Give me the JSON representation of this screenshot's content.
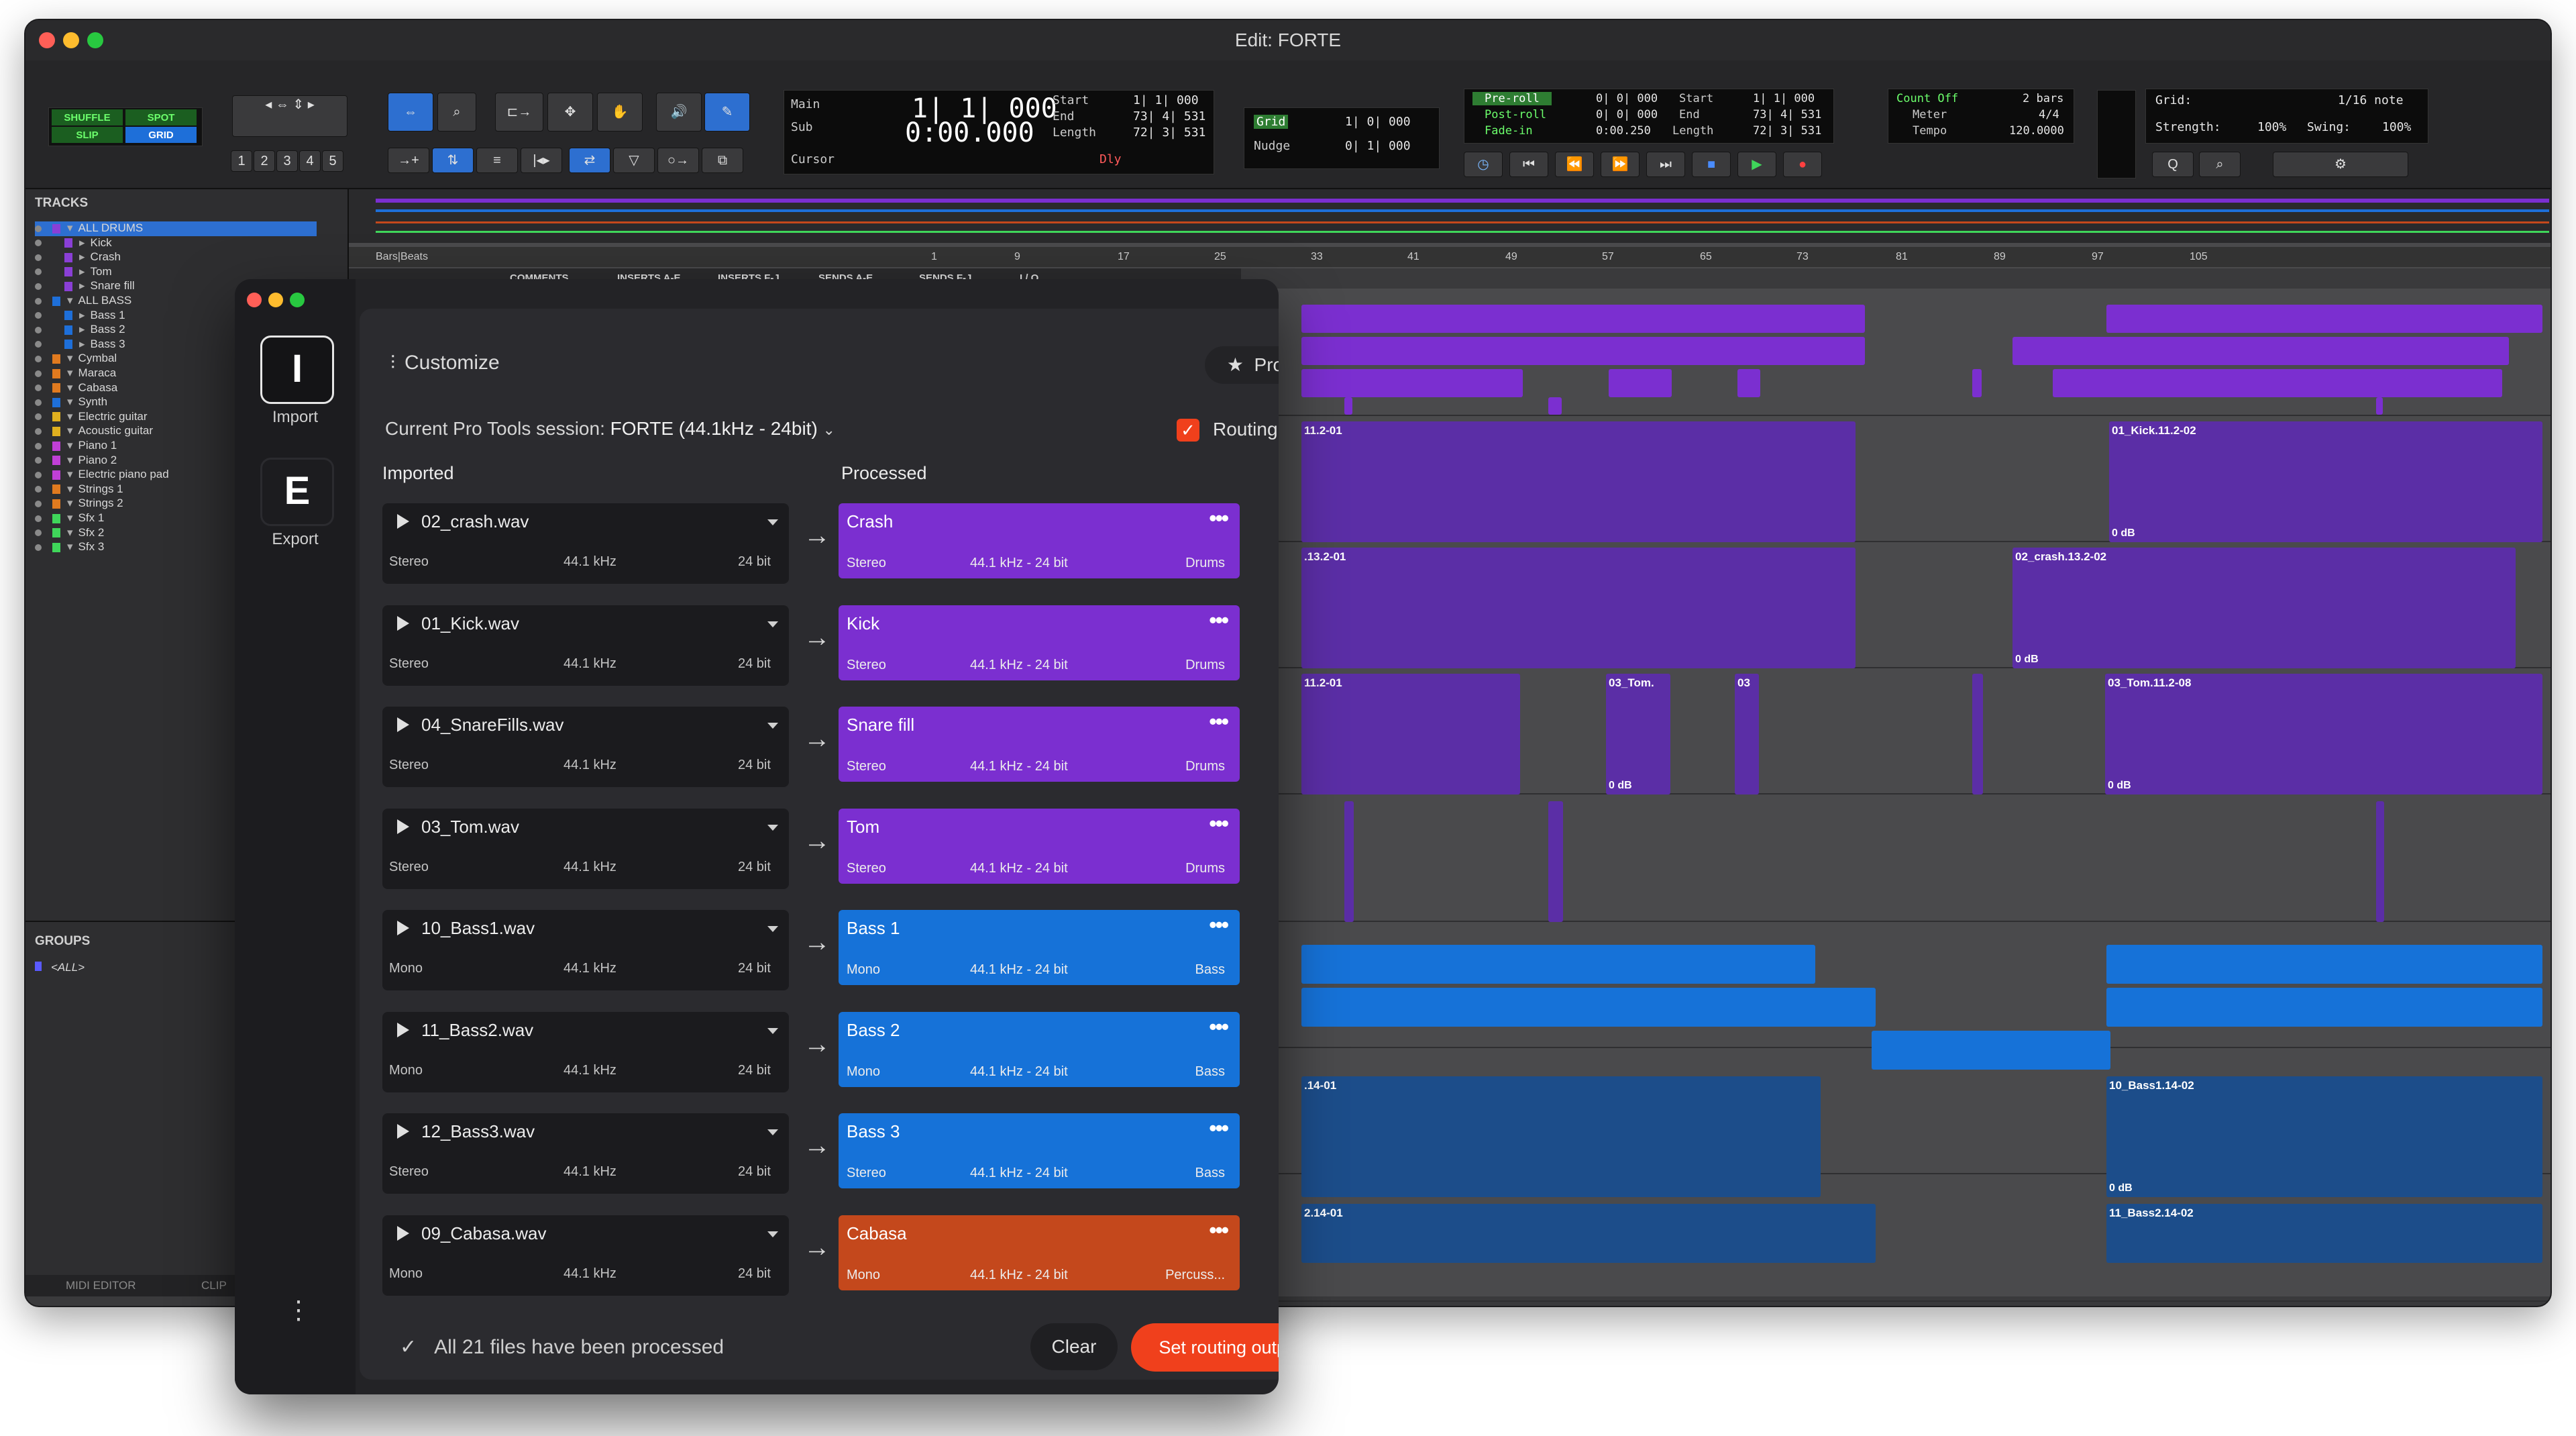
{
  "protools": {
    "window_title": "Edit: FORTE",
    "modes": {
      "shuffle": "SHUFFLE",
      "spot": "SPOT",
      "slip": "SLIP",
      "grid": "GRID"
    },
    "zoom_presets": [
      "1",
      "2",
      "3",
      "4",
      "5"
    ],
    "counters": {
      "main_label": "Main",
      "main_value": "1| 1| 000",
      "sub_label": "Sub",
      "sub_value": "0:00.000",
      "start_label": "Start",
      "start_value": "1| 1| 000",
      "end_label": "End",
      "end_value": "73| 4| 531",
      "length_label": "Length",
      "length_value": "72| 3| 531",
      "cursor_label": "Cursor",
      "dly_label": "Dly"
    },
    "grid_nudge": {
      "grid_label": "Grid",
      "grid_value": "1| 0| 000",
      "nudge_label": "Nudge",
      "nudge_value": "0| 1| 000"
    },
    "transport_lcd": {
      "preroll_label": "Pre-roll",
      "preroll_value": "0| 0| 000",
      "postroll_label": "Post-roll",
      "postroll_value": "0| 0| 000",
      "fadein_label": "Fade-in",
      "fadein_value": "0:00.250",
      "start_label": "Start",
      "start_value": "1| 1| 000",
      "end_label": "End",
      "end_value": "73| 4| 531",
      "length_label": "Length",
      "length_value": "72| 3| 531"
    },
    "count_meter": {
      "count_off_label": "Count Off",
      "count_off_value": "2 bars",
      "meter_label": "Meter",
      "meter_value": "4/4",
      "tempo_label": "Tempo",
      "tempo_value": "120.0000"
    },
    "grid_quant": {
      "grid_label": "Grid:",
      "grid_value": "1/16 note",
      "strength_label": "Strength:",
      "strength_value": "100%",
      "swing_label": "Swing:",
      "swing_value": "100%"
    },
    "tracks_header": "TRACKS",
    "groups_header": "GROUPS",
    "groups_all": "<ALL>",
    "bottom_tabs": [
      "MIDI EDITOR",
      "CLIP"
    ],
    "tracks": [
      {
        "name": "ALL DRUMS",
        "color": "#8a3fd6",
        "indent": 0
      },
      {
        "name": "Kick",
        "color": "#8a3fd6",
        "indent": 1
      },
      {
        "name": "Crash",
        "color": "#8a3fd6",
        "indent": 1
      },
      {
        "name": "Tom",
        "color": "#8a3fd6",
        "indent": 1
      },
      {
        "name": "Snare fill",
        "color": "#8a3fd6",
        "indent": 1
      },
      {
        "name": "ALL BASS",
        "color": "#1e6fd9",
        "indent": 0
      },
      {
        "name": "Bass 1",
        "color": "#1e6fd9",
        "indent": 1
      },
      {
        "name": "Bass 2",
        "color": "#1e6fd9",
        "indent": 1
      },
      {
        "name": "Bass 3",
        "color": "#1e6fd9",
        "indent": 1
      },
      {
        "name": "Cymbal",
        "color": "#e07a1f",
        "indent": 0
      },
      {
        "name": "Maraca",
        "color": "#e07a1f",
        "indent": 0
      },
      {
        "name": "Cabasa",
        "color": "#e07a1f",
        "indent": 0
      },
      {
        "name": "Synth",
        "color": "#1e6fd9",
        "indent": 0
      },
      {
        "name": "Electric guitar",
        "color": "#e0b01f",
        "indent": 0
      },
      {
        "name": "Acoustic guitar",
        "color": "#e0b01f",
        "indent": 0
      },
      {
        "name": "Piano 1",
        "color": "#c03fd6",
        "indent": 0
      },
      {
        "name": "Piano 2",
        "color": "#c03fd6",
        "indent": 0
      },
      {
        "name": "Electric piano pad",
        "color": "#c03fd6",
        "indent": 0
      },
      {
        "name": "Strings 1",
        "color": "#e07a1f",
        "indent": 0
      },
      {
        "name": "Strings 2",
        "color": "#e07a1f",
        "indent": 0
      },
      {
        "name": "Sfx 1",
        "color": "#3fd65a",
        "indent": 0
      },
      {
        "name": "Sfx 2",
        "color": "#3fd65a",
        "indent": 0
      },
      {
        "name": "Sfx 3",
        "color": "#3fd65a",
        "indent": 0
      }
    ],
    "ruler_label": "Bars|Beats",
    "ruler_marks": [
      "1",
      "9",
      "17",
      "25",
      "33",
      "41",
      "49",
      "57",
      "65",
      "73",
      "81",
      "89",
      "97",
      "105"
    ],
    "column_headers": [
      "COMMENTS",
      "INSERTS A-E",
      "INSERTS F-J",
      "SENDS A-E",
      "SENDS F-J",
      "I / O"
    ],
    "clip_names": {
      "kick_a": "11.2-01",
      "kick_b": "01_Kick.11.2-02",
      "crash_a": ".13.2-01",
      "crash_b": "02_crash.13.2-02",
      "tom_a": "11.2-01",
      "tom_b": "03_Tom.",
      "tom_c": "03",
      "tom_d": "03_Tom.11.2-08",
      "bass1_a": ".14-01",
      "bass1_b": "10_Bass1.14-02",
      "bass2_a": "2.14-01",
      "bass2_b": "11_Bass2.14-02",
      "zero_db": "0 dB"
    }
  },
  "app": {
    "sidebar": {
      "import_letter": "I",
      "import_label": "Import",
      "export_letter": "E",
      "export_label": "Export"
    },
    "header": {
      "title": "Customize",
      "pro_label": "Pro"
    },
    "session": {
      "prefix": "Current Pro Tools session: ",
      "name": "FORTE (44.1kHz - 24bit)",
      "routing_label": "Routing",
      "routing_checked": true
    },
    "columns": {
      "imported": "Imported",
      "processed": "Processed"
    },
    "rows": [
      {
        "file": "02_crash.wav",
        "channels": "Stereo",
        "rate": "44.1 kHz",
        "bits": "24 bit",
        "name": "Crash",
        "out_channels": "Stereo",
        "out_format": "44.1 kHz - 24 bit",
        "category": "Drums",
        "color": "#7b2fd0"
      },
      {
        "file": "01_Kick.wav",
        "channels": "Stereo",
        "rate": "44.1 kHz",
        "bits": "24 bit",
        "name": "Kick",
        "out_channels": "Stereo",
        "out_format": "44.1 kHz - 24 bit",
        "category": "Drums",
        "color": "#7b2fd0"
      },
      {
        "file": "04_SnareFills.wav",
        "channels": "Stereo",
        "rate": "44.1 kHz",
        "bits": "24 bit",
        "name": "Snare fill",
        "out_channels": "Stereo",
        "out_format": "44.1 kHz - 24 bit",
        "category": "Drums",
        "color": "#7b2fd0"
      },
      {
        "file": "03_Tom.wav",
        "channels": "Stereo",
        "rate": "44.1 kHz",
        "bits": "24 bit",
        "name": "Tom",
        "out_channels": "Stereo",
        "out_format": "44.1 kHz - 24 bit",
        "category": "Drums",
        "color": "#7b2fd0"
      },
      {
        "file": "10_Bass1.wav",
        "channels": "Mono",
        "rate": "44.1 kHz",
        "bits": "24 bit",
        "name": "Bass 1",
        "out_channels": "Mono",
        "out_format": "44.1 kHz - 24 bit",
        "category": "Bass",
        "color": "#1672d8"
      },
      {
        "file": "11_Bass2.wav",
        "channels": "Mono",
        "rate": "44.1 kHz",
        "bits": "24 bit",
        "name": "Bass 2",
        "out_channels": "Mono",
        "out_format": "44.1 kHz - 24 bit",
        "category": "Bass",
        "color": "#1672d8"
      },
      {
        "file": "12_Bass3.wav",
        "channels": "Stereo",
        "rate": "44.1 kHz",
        "bits": "24 bit",
        "name": "Bass 3",
        "out_channels": "Stereo",
        "out_format": "44.1 kHz - 24 bit",
        "category": "Bass",
        "color": "#1672d8"
      },
      {
        "file": "09_Cabasa.wav",
        "channels": "Mono",
        "rate": "44.1 kHz",
        "bits": "24 bit",
        "name": "Cabasa",
        "out_channels": "Mono",
        "out_format": "44.1 kHz - 24 bit",
        "category": "Percuss...",
        "color": "#c4481c"
      }
    ],
    "footer": {
      "status": "All 21 files have been processed",
      "clear_label": "Clear",
      "route_label": "Set routing outputs"
    },
    "colors": {
      "accent": "#f0401c",
      "drums": "#7b2fd0",
      "bass": "#1672d8",
      "percussion": "#c4481c"
    }
  }
}
